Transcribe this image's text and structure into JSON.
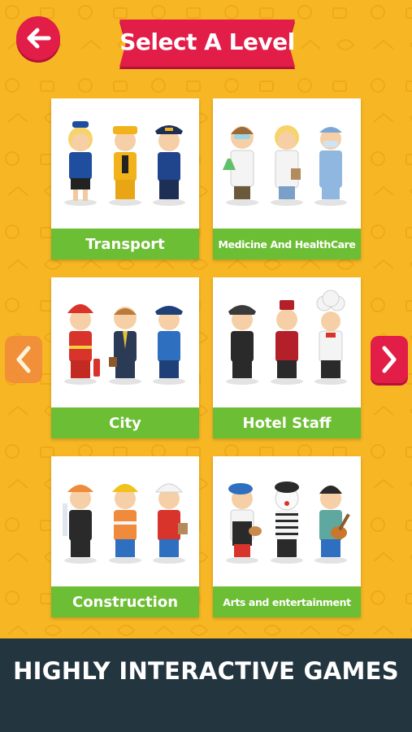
{
  "header": {
    "title": "Select A Level",
    "back_icon": "arrow-left-icon"
  },
  "levels": [
    {
      "label": "Transport"
    },
    {
      "label": "Medicine And HealthCare"
    },
    {
      "label": "City"
    },
    {
      "label": "Hotel Staff"
    },
    {
      "label": "Construction"
    },
    {
      "label": "Arts and entertainment"
    }
  ],
  "nav": {
    "prev_icon": "chevron-left-icon",
    "next_icon": "chevron-right-icon"
  },
  "footer": {
    "tagline": "HIGHLY INTERACTIVE GAMES"
  },
  "colors": {
    "background": "#f7b724",
    "accent_red": "#e11d48",
    "label_green": "#6cbe34",
    "footer": "#23353f",
    "prev_arrow": "#f08a3c"
  }
}
